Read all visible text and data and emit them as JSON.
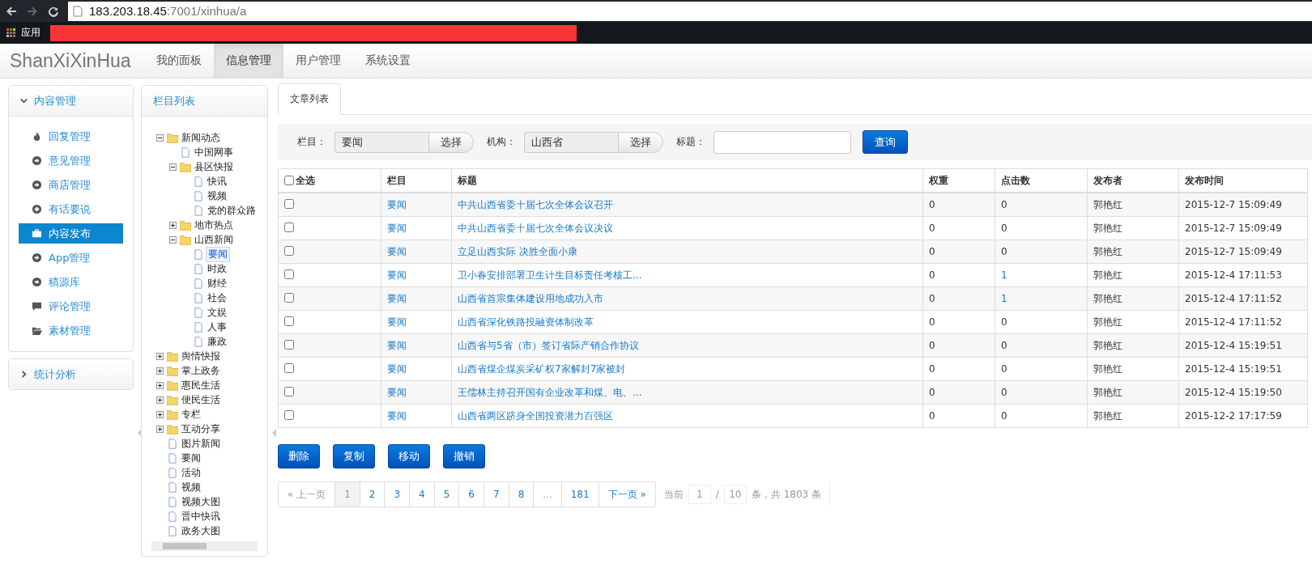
{
  "browser": {
    "url_host": "183.203.18.45",
    "url_path": ":7001/xinhua/a",
    "bookmarks": [
      {
        "label": "应用"
      }
    ]
  },
  "navbar": {
    "brand": "ShanXiXinHua",
    "tabs": [
      {
        "label": "我的面板",
        "selected": false
      },
      {
        "label": "信息管理",
        "selected": true
      },
      {
        "label": "用户管理",
        "selected": false
      },
      {
        "label": "系统设置",
        "selected": false
      }
    ]
  },
  "sidebar": {
    "sections": [
      {
        "title": "内容管理",
        "expanded": true,
        "items": [
          {
            "label": "回复管理",
            "kind": "flame",
            "selected": false
          },
          {
            "label": "意见管理",
            "kind": "arrow",
            "selected": false
          },
          {
            "label": "商店管理",
            "kind": "arrow",
            "selected": false
          },
          {
            "label": "有话要说",
            "kind": "plus",
            "selected": false
          },
          {
            "label": "内容发布",
            "kind": "briefcase",
            "selected": true
          },
          {
            "label": "App管理",
            "kind": "arrow",
            "selected": false
          },
          {
            "label": "稿源库",
            "kind": "arrow",
            "selected": false
          },
          {
            "label": "评论管理",
            "kind": "comment",
            "selected": false
          },
          {
            "label": "素材管理",
            "kind": "folder",
            "selected": false
          }
        ]
      },
      {
        "title": "统计分析",
        "expanded": false
      }
    ]
  },
  "tree_panel": {
    "title": "栏目列表",
    "nodes": [
      {
        "label": "新闻动态",
        "kind": "folder",
        "expanded": true,
        "selected": false,
        "children": [
          {
            "label": "中国网事",
            "kind": "page",
            "selected": false
          },
          {
            "label": "县区快报",
            "kind": "folder",
            "expanded": true,
            "selected": false,
            "children": [
              {
                "label": "快讯",
                "kind": "page",
                "selected": false
              },
              {
                "label": "视频",
                "kind": "page",
                "selected": false
              },
              {
                "label": "党的群众路",
                "kind": "page",
                "selected": false
              }
            ]
          },
          {
            "label": "地市热点",
            "kind": "folder",
            "expanded": false,
            "selected": false
          },
          {
            "label": "山西新闻",
            "kind": "folder",
            "expanded": true,
            "selected": false,
            "children": [
              {
                "label": "要闻",
                "kind": "page",
                "selected": true
              },
              {
                "label": "时政",
                "kind": "page",
                "selected": false
              },
              {
                "label": "财经",
                "kind": "page",
                "selected": false
              },
              {
                "label": "社会",
                "kind": "page",
                "selected": false
              },
              {
                "label": "文娱",
                "kind": "page",
                "selected": false
              },
              {
                "label": "人事",
                "kind": "page",
                "selected": false
              },
              {
                "label": "廉政",
                "kind": "page",
                "selected": false
              }
            ]
          }
        ]
      },
      {
        "label": "舆情快报",
        "kind": "folder",
        "expanded": false,
        "selected": false
      },
      {
        "label": "掌上政务",
        "kind": "folder",
        "expanded": false,
        "selected": false
      },
      {
        "label": "惠民生活",
        "kind": "folder",
        "expanded": false,
        "selected": false
      },
      {
        "label": "便民生活",
        "kind": "folder",
        "expanded": false,
        "selected": false
      },
      {
        "label": "专栏",
        "kind": "folder",
        "expanded": false,
        "selected": false
      },
      {
        "label": "互动分享",
        "kind": "folder",
        "expanded": false,
        "selected": false
      },
      {
        "label": "图片新闻",
        "kind": "page",
        "selected": false
      },
      {
        "label": "要闻",
        "kind": "page",
        "selected": false
      },
      {
        "label": "活动",
        "kind": "page",
        "selected": false
      },
      {
        "label": "视频",
        "kind": "page",
        "selected": false
      },
      {
        "label": "视频大图",
        "kind": "page",
        "selected": false
      },
      {
        "label": "晋中快讯",
        "kind": "page",
        "selected": false
      },
      {
        "label": "政务大图",
        "kind": "page",
        "selected": false
      }
    ]
  },
  "main": {
    "tabs": [
      {
        "label": "文章列表",
        "selected": true
      }
    ],
    "filters": {
      "column_label": "栏目：",
      "column_value": "要闻",
      "column_button": "选择",
      "org_label": "机构：",
      "org_value": "山西省",
      "org_button": "选择",
      "title_label": "标题：",
      "search_button": "查询"
    },
    "table": {
      "select_all": {
        "label": "全选",
        "checked": false
      },
      "columns": [
        "栏目",
        "标题",
        "权重",
        "点击数",
        "发布者",
        "发布时间"
      ],
      "rows": [
        {
          "checked": false,
          "column": "要闻",
          "title": "中共山西省委十届七次全体会议召开",
          "weight": "0",
          "clicks": "0",
          "publisher": "郭艳红",
          "time": "2015-12-7 15:09:49"
        },
        {
          "checked": false,
          "column": "要闻",
          "title": "中共山西省委十届七次全体会议决议",
          "weight": "0",
          "clicks": "0",
          "publisher": "郭艳红",
          "time": "2015-12-7 15:09:49"
        },
        {
          "checked": false,
          "column": "要闻",
          "title": "立足山西实际 决胜全面小康",
          "weight": "0",
          "clicks": "0",
          "publisher": "郭艳红",
          "time": "2015-12-7 15:09:49"
        },
        {
          "checked": false,
          "column": "要闻",
          "title": "卫小春安排部署卫生计生目标责任考核工...",
          "weight": "0",
          "clicks": "1",
          "publisher": "郭艳红",
          "time": "2015-12-4 17:11:53"
        },
        {
          "checked": false,
          "column": "要闻",
          "title": "山西省首宗集体建设用地成功入市",
          "weight": "0",
          "clicks": "1",
          "publisher": "郭艳红",
          "time": "2015-12-4 17:11:52"
        },
        {
          "checked": false,
          "column": "要闻",
          "title": "山西省深化铁路投融资体制改革",
          "weight": "0",
          "clicks": "0",
          "publisher": "郭艳红",
          "time": "2015-12-4 17:11:52"
        },
        {
          "checked": false,
          "column": "要闻",
          "title": "山西省与5省（市）签订省际产销合作协议",
          "weight": "0",
          "clicks": "0",
          "publisher": "郭艳红",
          "time": "2015-12-4 15:19:51"
        },
        {
          "checked": false,
          "column": "要闻",
          "title": "山西省煤企煤炭采矿权7家解封7家被封",
          "weight": "0",
          "clicks": "0",
          "publisher": "郭艳红",
          "time": "2015-12-4 15:19:51"
        },
        {
          "checked": false,
          "column": "要闻",
          "title": "王儒林主持召开国有企业改革和煤、电、...",
          "weight": "0",
          "clicks": "0",
          "publisher": "郭艳红",
          "time": "2015-12-4 15:19:50"
        },
        {
          "checked": false,
          "column": "要闻",
          "title": "山西省两区跻身全国投资潜力百强区",
          "weight": "0",
          "clicks": "0",
          "publisher": "郭艳红",
          "time": "2015-12-2 17:17:59"
        }
      ]
    },
    "actions": [
      "删除",
      "复制",
      "移动",
      "撤销"
    ],
    "pagination": {
      "pages": [
        {
          "label": "« 上一页",
          "selected": false,
          "disabled": true
        },
        {
          "label": "1",
          "selected": true,
          "disabled": false
        },
        {
          "label": "2",
          "selected": false,
          "disabled": false
        },
        {
          "label": "3",
          "selected": false,
          "disabled": false
        },
        {
          "label": "4",
          "selected": false,
          "disabled": false
        },
        {
          "label": "5",
          "selected": false,
          "disabled": false
        },
        {
          "label": "6",
          "selected": false,
          "disabled": false
        },
        {
          "label": "7",
          "selected": false,
          "disabled": false
        },
        {
          "label": "8",
          "selected": false,
          "disabled": false
        },
        {
          "label": "...",
          "selected": false,
          "disabled": true
        },
        {
          "label": "181",
          "selected": false,
          "disabled": false
        },
        {
          "label": "下一页 »",
          "selected": false,
          "disabled": false
        }
      ],
      "current_label": "当前",
      "current_page": "1",
      "separator": "/",
      "page_size": "10",
      "total_text": "条，共 1803 条"
    }
  }
}
